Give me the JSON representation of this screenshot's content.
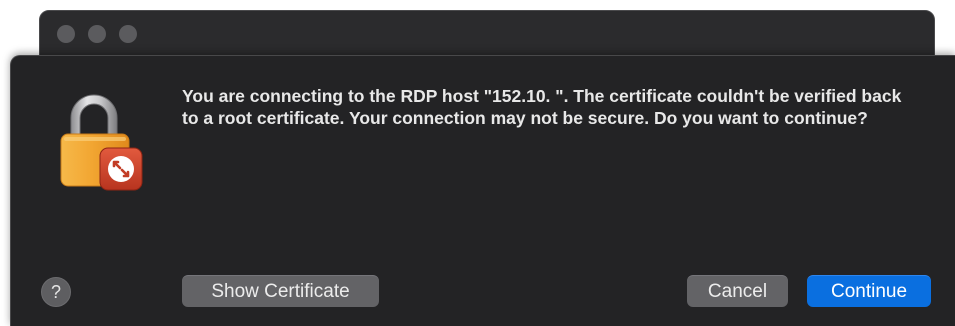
{
  "dialog": {
    "message": "You are connecting to the RDP host \"152.10.           \". The certificate couldn't be verified back to a root certificate. Your connection may not be secure. Do you want to continue?",
    "icon": "lock-rdp-icon"
  },
  "buttons": {
    "help_label": "?",
    "show_certificate_label": "Show Certificate",
    "cancel_label": "Cancel",
    "continue_label": "Continue"
  },
  "colors": {
    "accent": "#0a6fe0",
    "dialog_background": "#232325",
    "button_gray": "#636366",
    "lock_body": "#f0a22e",
    "rdp_badge": "#d2452f"
  }
}
